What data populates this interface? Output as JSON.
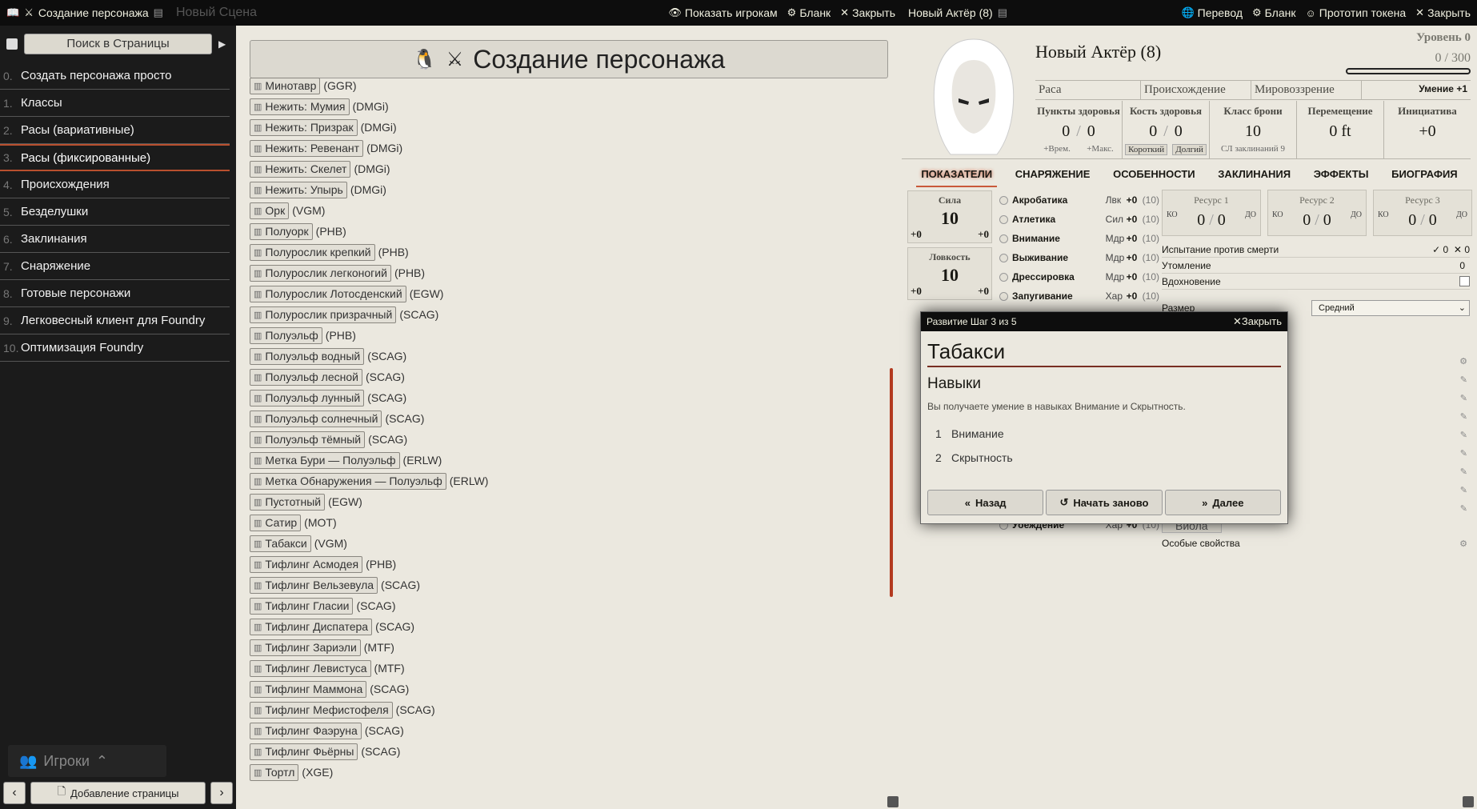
{
  "journal": {
    "title": "Создание персонажа",
    "ghost_scene": "Новый Сцена",
    "buttons": {
      "show_players": "Показать игрокам",
      "sheet": "Бланк",
      "close": "Закрыть"
    },
    "search_placeholder": "Поиск в Страницы",
    "toc": [
      {
        "num": "0.",
        "label": "Создать персонажа просто"
      },
      {
        "num": "1.",
        "label": "Классы"
      },
      {
        "num": "2.",
        "label": "Расы (вариативные)"
      },
      {
        "num": "3.",
        "label": "Расы (фиксированные)"
      },
      {
        "num": "4.",
        "label": "Происхождения"
      },
      {
        "num": "5.",
        "label": "Безделушки"
      },
      {
        "num": "6.",
        "label": "Заклинания"
      },
      {
        "num": "7.",
        "label": "Снаряжение"
      },
      {
        "num": "8.",
        "label": "Готовые персонажи"
      },
      {
        "num": "9.",
        "label": "Легковесный клиент для Foundry"
      },
      {
        "num": "10.",
        "label": "Оптимизация Foundry"
      }
    ],
    "players_label": "Игроки",
    "add_page": "Добавление страницы",
    "page_title": "Создание персонажа",
    "races": [
      {
        "name": "Минотавр",
        "src": "(GGR)"
      },
      {
        "name": "Нежить: Мумия",
        "src": "(DMGi)"
      },
      {
        "name": "Нежить: Призрак",
        "src": "(DMGi)"
      },
      {
        "name": "Нежить: Ревенант",
        "src": "(DMGi)"
      },
      {
        "name": "Нежить: Скелет",
        "src": "(DMGi)"
      },
      {
        "name": "Нежить: Упырь",
        "src": "(DMGi)"
      },
      {
        "name": "Орк",
        "src": "(VGM)"
      },
      {
        "name": "Полуорк",
        "src": "(PHB)"
      },
      {
        "name": "Полурослик крепкий",
        "src": "(PHB)"
      },
      {
        "name": "Полурослик легконогий",
        "src": "(PHB)"
      },
      {
        "name": "Полурослик Лотосденский",
        "src": "(EGW)"
      },
      {
        "name": "Полурослик призрачный",
        "src": "(SCAG)"
      },
      {
        "name": "Полуэльф",
        "src": "(PHB)"
      },
      {
        "name": "Полуэльф водный",
        "src": "(SCAG)"
      },
      {
        "name": "Полуэльф лесной",
        "src": "(SCAG)"
      },
      {
        "name": "Полуэльф лунный",
        "src": "(SCAG)"
      },
      {
        "name": "Полуэльф солнечный",
        "src": "(SCAG)"
      },
      {
        "name": "Полуэльф тёмный",
        "src": "(SCAG)"
      },
      {
        "name": "Метка Бури — Полуэльф",
        "src": "(ERLW)"
      },
      {
        "name": "Метка Обнаружения — Полуэльф",
        "src": "(ERLW)"
      },
      {
        "name": "Пустотный",
        "src": "(EGW)"
      },
      {
        "name": "Сатир",
        "src": "(MOT)"
      },
      {
        "name": "Табакси",
        "src": "(VGM)"
      },
      {
        "name": "Тифлинг Асмодея",
        "src": "(PHB)"
      },
      {
        "name": "Тифлинг Вельзевула",
        "src": "(SCAG)"
      },
      {
        "name": "Тифлинг Гласии",
        "src": "(SCAG)"
      },
      {
        "name": "Тифлинг Диспатера",
        "src": "(SCAG)"
      },
      {
        "name": "Тифлинг Зариэли",
        "src": "(MTF)"
      },
      {
        "name": "Тифлинг Левистуса",
        "src": "(MTF)"
      },
      {
        "name": "Тифлинг Маммона",
        "src": "(SCAG)"
      },
      {
        "name": "Тифлинг Мефистофеля",
        "src": "(SCAG)"
      },
      {
        "name": "Тифлинг Фаэруна",
        "src": "(SCAG)"
      },
      {
        "name": "Тифлинг Фьёрны",
        "src": "(SCAG)"
      },
      {
        "name": "Тортл",
        "src": "(XGE)"
      }
    ]
  },
  "sheet": {
    "title": "Новый Актёр (8)",
    "buttons": {
      "translate": "Перевод",
      "sheet": "Бланк",
      "token": "Прототип токена",
      "close": "Закрыть"
    },
    "actor_name": "Новый Актёр (8)",
    "level": "Уровень 0",
    "xp": "0 / 300",
    "xp_fraction": 0,
    "summary": {
      "race": "Раса",
      "origin": "Происхождение",
      "alignment": "Мировоззрение",
      "proficiency": "Умение +1"
    },
    "hp": {
      "label": "Пункты здоровья",
      "value": "0",
      "max": "0",
      "temp": "+Врем.",
      "maxlabel": "+Макс."
    },
    "hd": {
      "label": "Кость здоровья",
      "value": "0",
      "max": "0",
      "short": "Короткий",
      "long": "Долгий"
    },
    "ac": {
      "label": "Класс брони",
      "value": "10",
      "dc": "СЛ заклинаний 9"
    },
    "move": {
      "label": "Перемещение",
      "value": "0 ft"
    },
    "init": {
      "label": "Инициатива",
      "value": "+0"
    },
    "tabs": [
      "ПОКАЗАТЕЛИ",
      "СНАРЯЖЕНИЕ",
      "ОСОБЕННОСТИ",
      "ЗАКЛИНАНИЯ",
      "ЭФФЕКТЫ",
      "БИОГРАФИЯ"
    ],
    "abilities": [
      {
        "name": "Сила",
        "score": "10",
        "mod": "+0",
        "save": "+0"
      },
      {
        "name": "Ловкость",
        "score": "10",
        "mod": "+0",
        "save": "+0"
      }
    ],
    "skills": [
      {
        "name": "Акробатика",
        "ab": "Лвк",
        "mod": "+0",
        "pp": "(10)"
      },
      {
        "name": "Атлетика",
        "ab": "Сил",
        "mod": "+0",
        "pp": "(10)"
      },
      {
        "name": "Внимание",
        "ab": "Мдр",
        "mod": "+0",
        "pp": "(10)"
      },
      {
        "name": "Выживание",
        "ab": "Мдр",
        "mod": "+0",
        "pp": "(10)"
      },
      {
        "name": "Дрессировка",
        "ab": "Мдр",
        "mod": "+0",
        "pp": "(10)"
      },
      {
        "name": "Запугивание",
        "ab": "Хар",
        "mod": "+0",
        "pp": "(10)"
      }
    ],
    "last_skill": {
      "name": "Убеждение",
      "ab": "Хар",
      "mod": "+0",
      "pp": "(10)"
    },
    "resources": [
      {
        "name": "Ресурс 1",
        "value": "0",
        "max": "0"
      },
      {
        "name": "Ресурс 2",
        "value": "0",
        "max": "0"
      },
      {
        "name": "Ресурс 3",
        "value": "0",
        "max": "0"
      }
    ],
    "ko": "КО",
    "do": "ДО",
    "death_saves": {
      "label": "Испытание против смерти",
      "success": "0",
      "fail": "0"
    },
    "exhaustion": {
      "label": "Утомление",
      "value": "0"
    },
    "inspiration": "Вдохновение",
    "size": {
      "label": "Размер",
      "value": "Средний"
    },
    "viola": "Виола",
    "special": "Особые свойства"
  },
  "dialog": {
    "header": "Развитие Шаг 3 из 5",
    "close": "Закрыть",
    "title": "Табакси",
    "subtitle": "Навыки",
    "text": "Вы получаете умение в навыках Внимание и Скрытность.",
    "items": [
      {
        "i": "1",
        "label": "Внимание"
      },
      {
        "i": "2",
        "label": "Скрытность"
      }
    ],
    "back": "Назад",
    "restart": "Начать заново",
    "next": "Далее"
  }
}
